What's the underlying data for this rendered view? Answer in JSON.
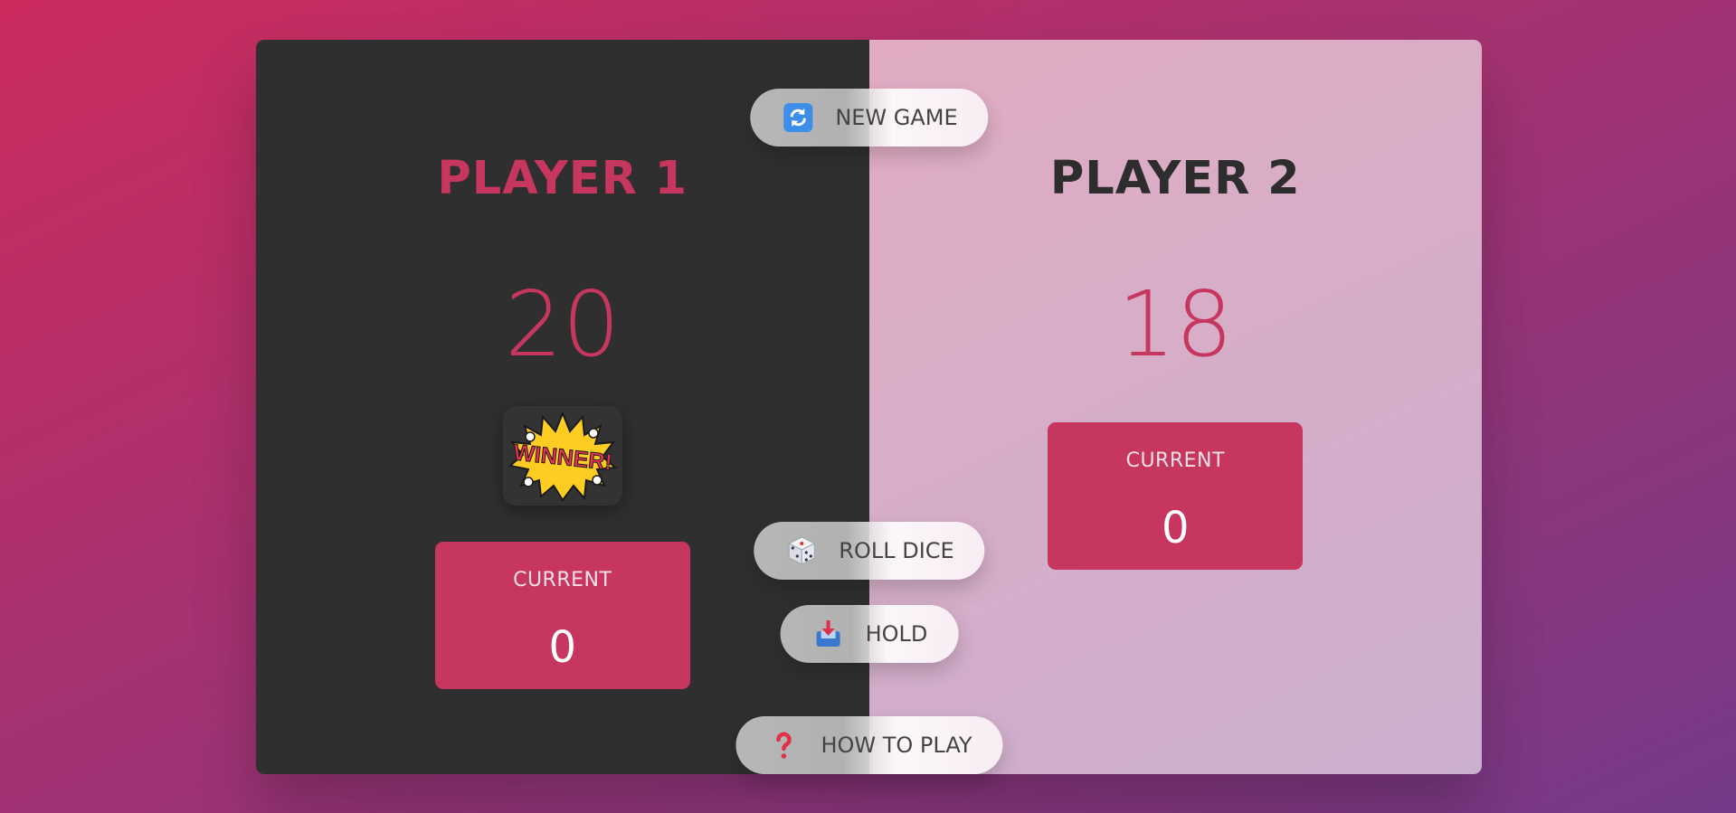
{
  "players": [
    {
      "name": "Player 1",
      "score": "20",
      "current_label": "Current",
      "current_score": "0",
      "winner": true,
      "winner_badge": "WINNER!"
    },
    {
      "name": "Player 2",
      "score": "18",
      "current_label": "Current",
      "current_score": "0",
      "winner": false
    }
  ],
  "buttons": {
    "new_game": {
      "label": "New game",
      "icon": "refresh-icon"
    },
    "roll_dice": {
      "label": "Roll dice",
      "icon": "dice-icon"
    },
    "hold": {
      "label": "Hold",
      "icon": "inbox-tray-icon"
    },
    "how_to_play": {
      "label": "How to play",
      "icon": "question-mark-icon"
    }
  },
  "colors": {
    "accent": "#c7365f",
    "player1_panel": "#2f2f2f",
    "player2_panel": "#d6b1c2",
    "background_start": "#cc2b5e",
    "background_end": "#753a88"
  }
}
